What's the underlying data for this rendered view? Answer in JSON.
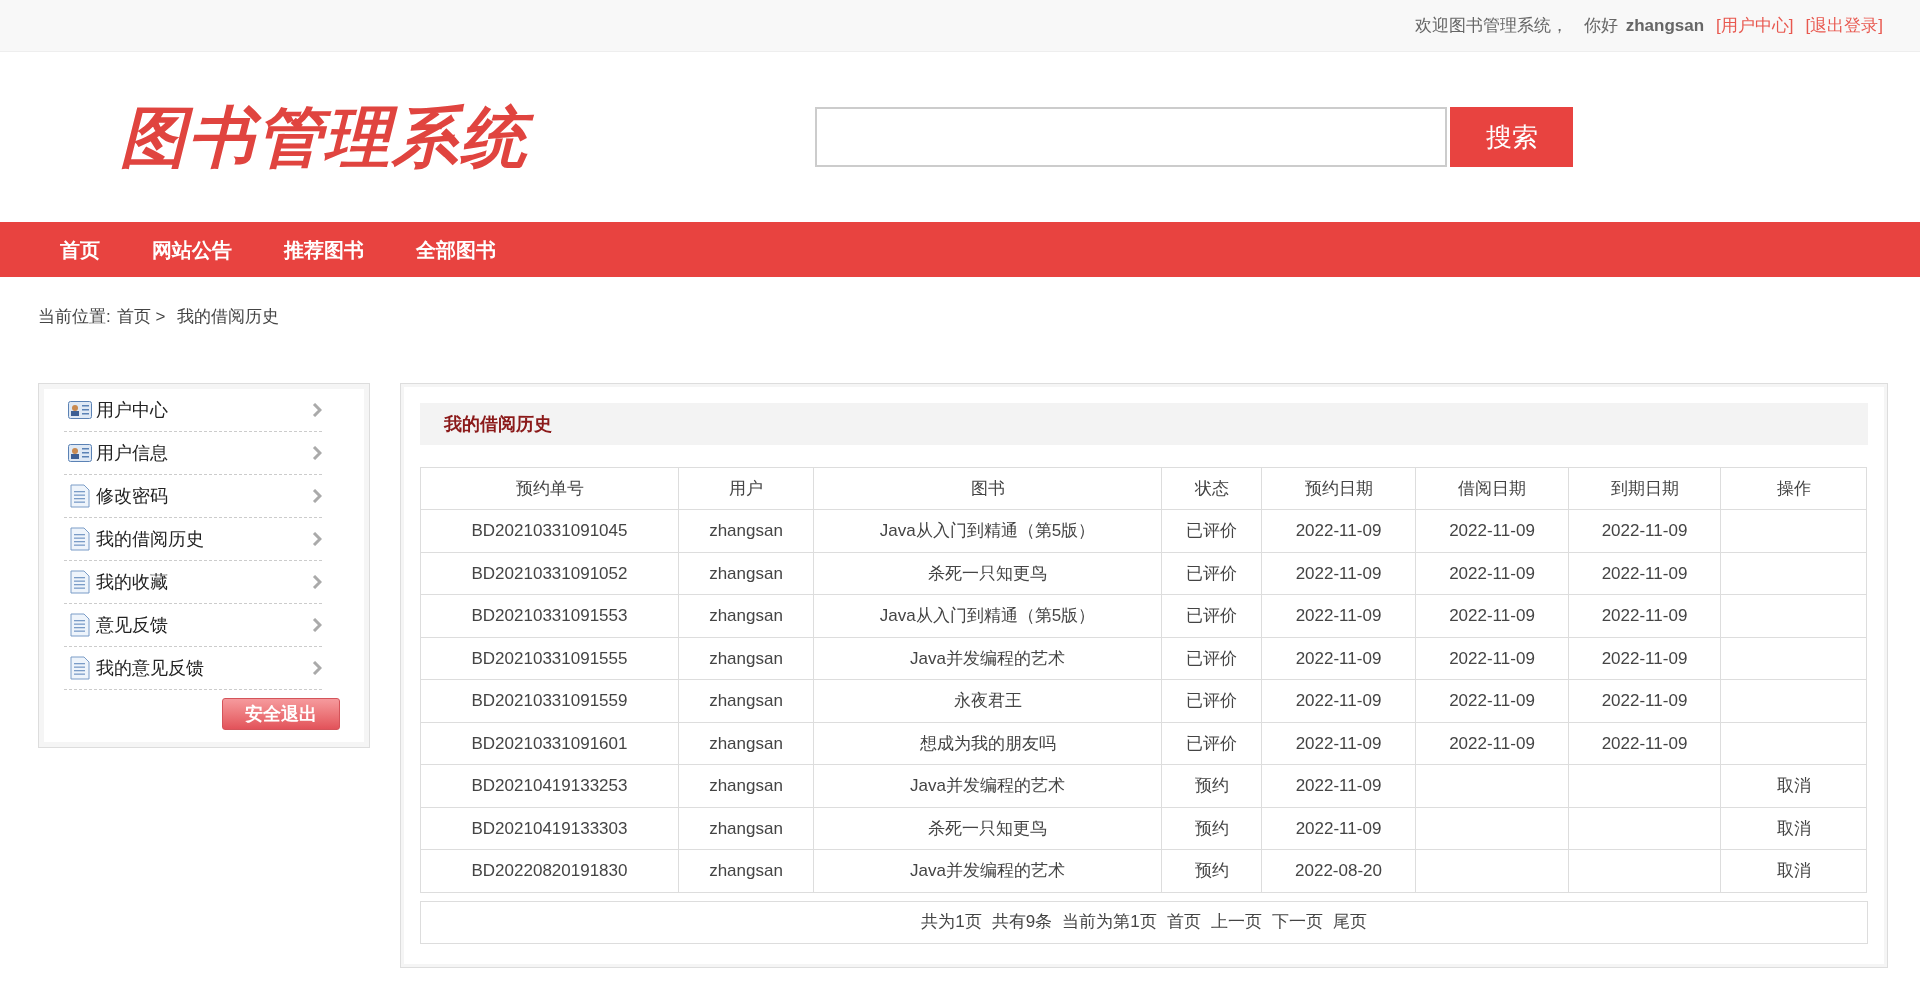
{
  "top_bar": {
    "welcome": "欢迎图书管理系统，",
    "greeting": "你好",
    "username": "zhangsan",
    "links": [
      "[用户中心]",
      "[退出登录]"
    ]
  },
  "header": {
    "logo": "图书管理系统",
    "search_button": "搜索"
  },
  "nav": [
    "首页",
    "网站公告",
    "推荐图书",
    "全部图书"
  ],
  "breadcrumb": {
    "label": "当前位置:",
    "home": "首页 >",
    "current": "我的借阅历史"
  },
  "sidebar": {
    "items": [
      {
        "label": "用户中心",
        "kind": "card"
      },
      {
        "label": "用户信息",
        "kind": "card"
      },
      {
        "label": "修改密码",
        "kind": "doc"
      },
      {
        "label": "我的借阅历史",
        "kind": "doc"
      },
      {
        "label": "我的收藏",
        "kind": "doc"
      },
      {
        "label": "意见反馈",
        "kind": "doc"
      },
      {
        "label": "我的意见反馈",
        "kind": "doc"
      }
    ],
    "logout_button": "安全退出"
  },
  "panel": {
    "title": "我的借阅历史",
    "table": {
      "columns": [
        "预约单号",
        "用户",
        "图书",
        "状态",
        "预约日期",
        "借阅日期",
        "到期日期",
        "操作"
      ],
      "rows": [
        [
          "BD20210331091045",
          "zhangsan",
          "Java从入门到精通（第5版）",
          "已评价",
          "2022-11-09",
          "2022-11-09",
          "2022-11-09",
          ""
        ],
        [
          "BD20210331091052",
          "zhangsan",
          "杀死一只知更鸟",
          "已评价",
          "2022-11-09",
          "2022-11-09",
          "2022-11-09",
          ""
        ],
        [
          "BD20210331091553",
          "zhangsan",
          "Java从入门到精通（第5版）",
          "已评价",
          "2022-11-09",
          "2022-11-09",
          "2022-11-09",
          ""
        ],
        [
          "BD20210331091555",
          "zhangsan",
          "Java并发编程的艺术",
          "已评价",
          "2022-11-09",
          "2022-11-09",
          "2022-11-09",
          ""
        ],
        [
          "BD20210331091559",
          "zhangsan",
          "永夜君王",
          "已评价",
          "2022-11-09",
          "2022-11-09",
          "2022-11-09",
          ""
        ],
        [
          "BD20210331091601",
          "zhangsan",
          "想成为我的朋友吗",
          "已评价",
          "2022-11-09",
          "2022-11-09",
          "2022-11-09",
          ""
        ],
        [
          "BD20210419133253",
          "zhangsan",
          "Java并发编程的艺术",
          "预约",
          "2022-11-09",
          "",
          "",
          "取消"
        ],
        [
          "BD20210419133303",
          "zhangsan",
          "杀死一只知更鸟",
          "预约",
          "2022-11-09",
          "",
          "",
          "取消"
        ],
        [
          "BD20220820191830",
          "zhangsan",
          "Java并发编程的艺术",
          "预约",
          "2022-08-20",
          "",
          "",
          "取消"
        ]
      ]
    },
    "pagination": {
      "info": [
        "共为1页",
        "共有9条",
        "当前为第1页"
      ],
      "links": [
        "首页",
        "上一页",
        "下一页",
        "尾页"
      ]
    }
  }
}
